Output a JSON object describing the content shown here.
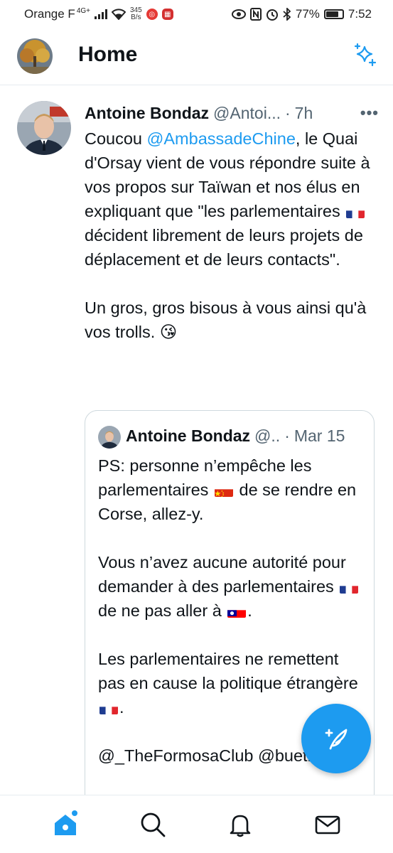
{
  "status_bar": {
    "carrier": "Orange F",
    "network": "4G+",
    "speed_value": "345",
    "speed_unit": "B/s",
    "battery": "77%",
    "time": "7:52"
  },
  "header": {
    "title": "Home"
  },
  "tweet": {
    "author": "Antoine Bondaz",
    "handle": "@Antoi...",
    "time": "7h",
    "more": "•••",
    "text": {
      "p1_prefix": "Coucou ",
      "mention": "@AmbassadeChine",
      "p1_rest": ", le Quai d'Orsay vient de vous répondre suite à vos propos sur Taïwan et nos élus en expliquant que \"les parlementaires ",
      "p1_end": " décident librement de leurs projets de déplacement et de leurs contacts\".",
      "p2": "Un gros, gros bisous à vous ainsi qu'à vos trolls. ",
      "emoji": "😘"
    }
  },
  "quoted_tweet": {
    "author": "Antoine Bondaz",
    "handle": "@..",
    "time": "Mar 15",
    "p1_a": "PS: personne n’empêche les parlementaires ",
    "p1_b": " de se rendre en Corse, allez-y.",
    "p2_a": "Vous n’avez aucune autorité pour demander à des parlementaires ",
    "p2_b": " de ne pas aller à ",
    "p2_c": ".",
    "p3_a": "Les parlementaires ne remettent pas en cause la politique étrangère ",
    "p3_b": ".",
    "p4": "@_TheFormosaClub @bueti"
  },
  "colors": {
    "accent": "#1d9bf0",
    "text": "#0f1419",
    "secondary": "#536471"
  },
  "icons": {
    "compose": "compose-feather-icon",
    "sparkle": "sparkle-icon",
    "home": "home-icon",
    "search": "search-icon",
    "notifications": "bell-icon",
    "messages": "mail-icon"
  }
}
